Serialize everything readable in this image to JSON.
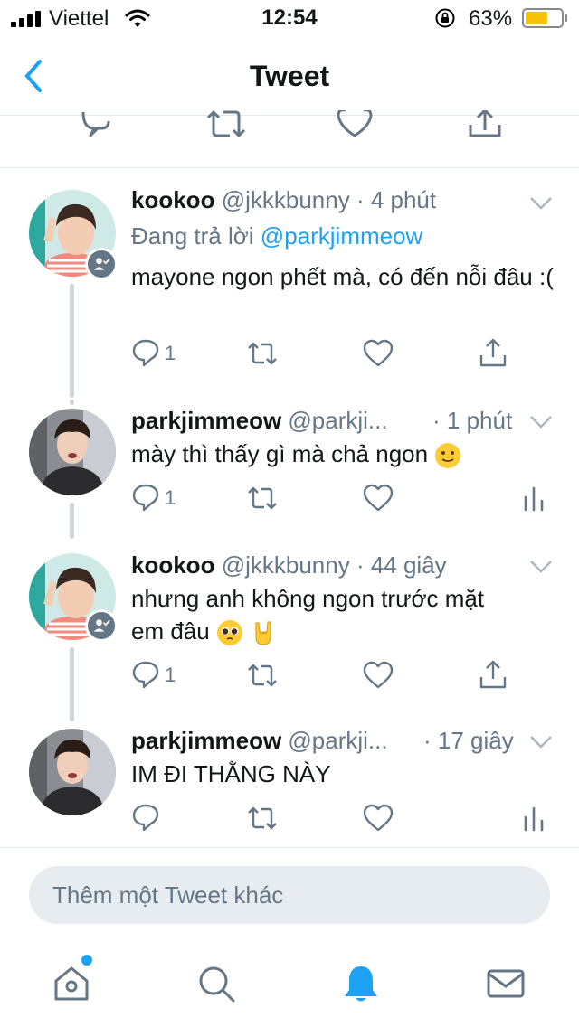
{
  "status": {
    "carrier": "Viettel",
    "time": "12:54",
    "battery_percent": "63%",
    "battery_level": 0.63,
    "battery_color": "#f5c400"
  },
  "nav": {
    "title": "Tweet",
    "back_icon": "chevron-left-icon"
  },
  "colors": {
    "accent": "#1da1f2",
    "secondary_text": "#657786",
    "divider": "#e1e8ed"
  },
  "thread": [
    {
      "name": "kookoo",
      "handle": "@jkkkbunny",
      "time": "· 4 phút",
      "reply_prefix": "Đang trả lời",
      "reply_mention": "@parkjimmeow",
      "text": "mayone ngon phết mà, có đến nỗi đâu :(",
      "reply_count": "1",
      "last_action": "share-icon"
    },
    {
      "name": "parkjimmeow",
      "handle": "@parkji...",
      "time": "· 1 phút",
      "text": "mày thì thấy gì mà chả ngon",
      "reply_count": "1",
      "last_action": "analytics-icon"
    },
    {
      "name": "kookoo",
      "handle": "@jkkkbunny",
      "time": "· 44 giây",
      "text_line1": "nhưng anh không ngon trước mặt",
      "text_line2": "em đâu",
      "reply_count": "1",
      "last_action": "share-icon"
    },
    {
      "name": "parkjimmeow",
      "handle": "@parkji...",
      "time": "· 17 giây",
      "text": "IM ĐI THẰNG NÀY",
      "reply_count": "",
      "last_action": "analytics-icon"
    }
  ],
  "compose": {
    "placeholder": "Thêm một Tweet khác"
  },
  "tabbar": [
    "home-icon",
    "search-icon",
    "notifications-icon",
    "messages-icon"
  ]
}
